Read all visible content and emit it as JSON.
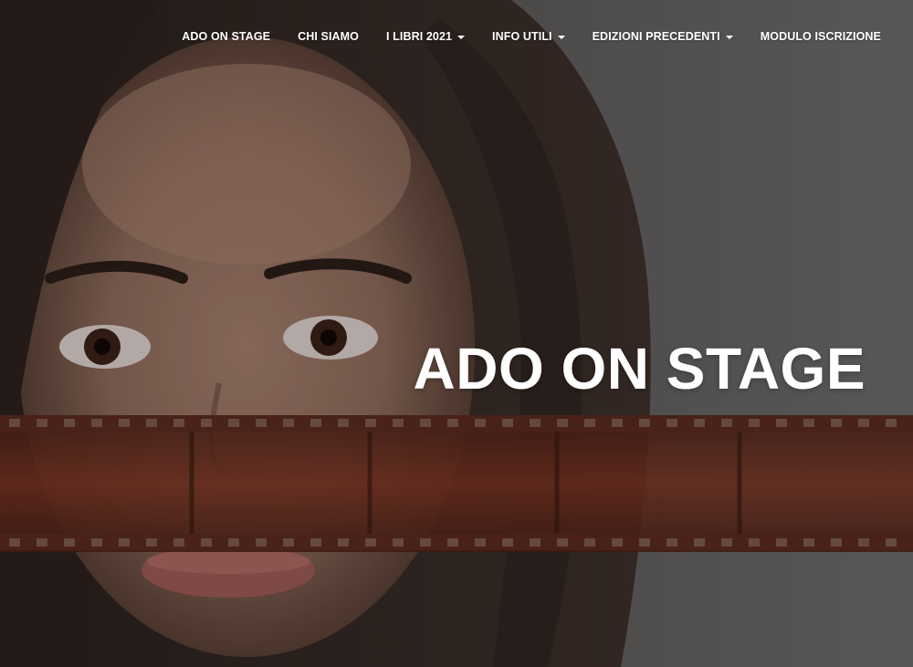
{
  "nav": {
    "items": [
      {
        "label": "ADO ON STAGE",
        "dropdown": false
      },
      {
        "label": "CHI SIAMO",
        "dropdown": false
      },
      {
        "label": "I LIBRI 2021",
        "dropdown": true
      },
      {
        "label": "INFO UTILI",
        "dropdown": true
      },
      {
        "label": "EDIZIONI PRECEDENTI",
        "dropdown": true
      },
      {
        "label": "MODULO ISCRIZIONE",
        "dropdown": false
      }
    ]
  },
  "hero": {
    "title": "ADO ON STAGE",
    "image": "portrait-with-film-strip"
  },
  "colors": {
    "nav_text": "#ffffff",
    "title_text": "#ffffff",
    "film_strip": "#6b2a1c"
  }
}
